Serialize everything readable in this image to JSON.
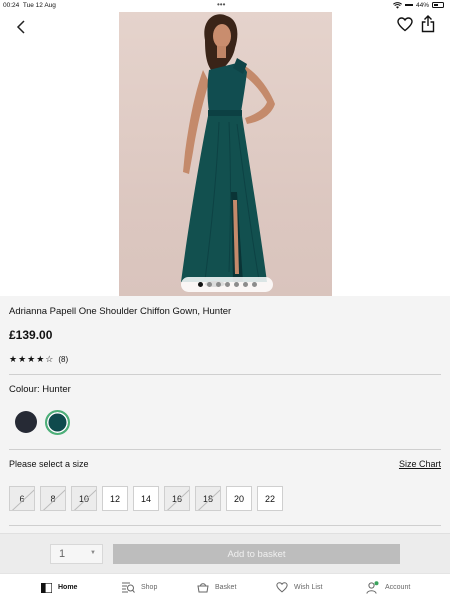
{
  "status_bar": {
    "time": "00:24",
    "date": "Tue 12 Aug",
    "battery": "44%"
  },
  "product": {
    "title": "Adrianna Papell One Shoulder Chiffon Gown, Hunter",
    "price": "£139.00",
    "rating_stars": 4,
    "rating_max": 5,
    "review_count": "(8)",
    "colour_label": "Colour: Hunter",
    "colours": [
      {
        "name": "navy",
        "hex": "#262a35",
        "selected": false
      },
      {
        "name": "hunter",
        "hex": "#0f4a4d",
        "selected": true
      }
    ],
    "images_total": 7,
    "image_active": 1
  },
  "size_selector": {
    "prompt": "Please select a size",
    "chart_link": "Size Chart",
    "sizes": [
      {
        "label": "6",
        "available": false
      },
      {
        "label": "8",
        "available": false
      },
      {
        "label": "10",
        "available": false
      },
      {
        "label": "12",
        "available": true
      },
      {
        "label": "14",
        "available": true
      },
      {
        "label": "16",
        "available": false
      },
      {
        "label": "18",
        "available": false
      },
      {
        "label": "20",
        "available": true
      },
      {
        "label": "22",
        "available": true
      }
    ]
  },
  "basket_bar": {
    "quantity": "1",
    "add_label": "Add to basket"
  },
  "nav": {
    "home": "Home",
    "shop": "Shop",
    "basket": "Basket",
    "wish_list": "Wish List",
    "account": "Account"
  },
  "colors": {
    "accent_green": "#4caf78",
    "dress": "#0f4a4d"
  }
}
